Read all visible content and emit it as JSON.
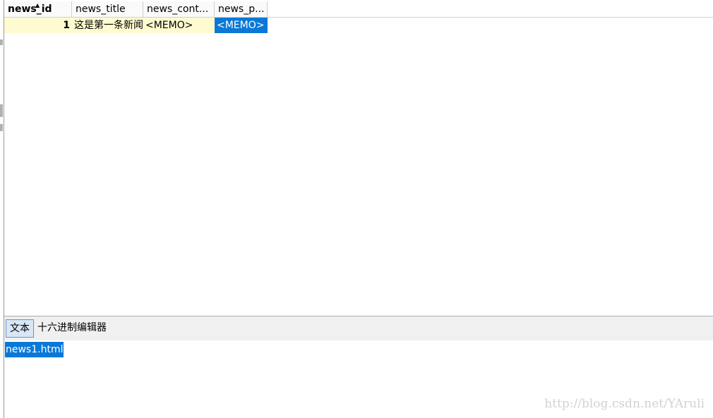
{
  "grid": {
    "columns": [
      {
        "label": "news_id"
      },
      {
        "label": "news_title"
      },
      {
        "label": "news_cont..."
      },
      {
        "label": "news_p..."
      }
    ],
    "rows": [
      {
        "news_id": "1",
        "news_title": "这是第一条新闻",
        "news_content": "<MEMO>",
        "news_p": "<MEMO>"
      }
    ]
  },
  "tabs": {
    "text": "文本",
    "hex": "十六进制编辑器"
  },
  "editor": {
    "value": "news1.html"
  },
  "watermark": "http://blog.csdn.net/YAruli",
  "colors": {
    "row_bg": "#fffbd0",
    "selection": "#0a78d7",
    "tab_active_bg": "#d9e6f5",
    "tabbar_bg": "#f0f0f0"
  }
}
